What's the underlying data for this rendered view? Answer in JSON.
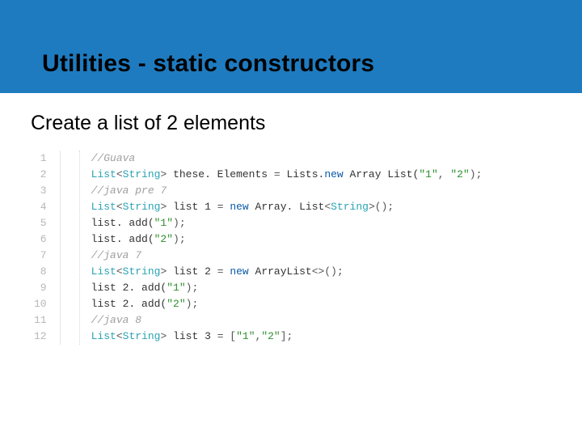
{
  "header": {
    "title": "Utilities - static constructors"
  },
  "subhead": "Create a list of 2 elements",
  "code": {
    "lines": [
      {
        "n": "1",
        "tokens": [
          {
            "t": "//Guava",
            "c": "comment"
          }
        ]
      },
      {
        "n": "2",
        "tokens": [
          {
            "t": "List",
            "c": "type"
          },
          {
            "t": "<",
            "c": "op"
          },
          {
            "t": "String",
            "c": "generic"
          },
          {
            "t": ">",
            "c": "op"
          },
          {
            "t": " these. Elements ",
            "c": "id"
          },
          {
            "t": "=",
            "c": "op"
          },
          {
            "t": " Lists.",
            "c": "id"
          },
          {
            "t": "new",
            "c": "kw"
          },
          {
            "t": " Array List(",
            "c": "id"
          },
          {
            "t": "\"1\"",
            "c": "str"
          },
          {
            "t": ", ",
            "c": "op"
          },
          {
            "t": "\"2\"",
            "c": "str"
          },
          {
            "t": ");",
            "c": "op"
          }
        ]
      },
      {
        "n": "3",
        "tokens": [
          {
            "t": "//java pre 7",
            "c": "comment"
          }
        ]
      },
      {
        "n": "4",
        "tokens": [
          {
            "t": "List",
            "c": "type"
          },
          {
            "t": "<",
            "c": "op"
          },
          {
            "t": "String",
            "c": "generic"
          },
          {
            "t": ">",
            "c": "op"
          },
          {
            "t": " list 1 ",
            "c": "id"
          },
          {
            "t": "=",
            "c": "op"
          },
          {
            "t": " ",
            "c": "id"
          },
          {
            "t": "new",
            "c": "kw"
          },
          {
            "t": " Array. List",
            "c": "id"
          },
          {
            "t": "<",
            "c": "op"
          },
          {
            "t": "String",
            "c": "generic"
          },
          {
            "t": ">",
            "c": "op"
          },
          {
            "t": "();",
            "c": "op"
          }
        ]
      },
      {
        "n": "5",
        "tokens": [
          {
            "t": "list. add(",
            "c": "id"
          },
          {
            "t": "\"1\"",
            "c": "str"
          },
          {
            "t": ");",
            "c": "op"
          }
        ]
      },
      {
        "n": "6",
        "tokens": [
          {
            "t": "list. add(",
            "c": "id"
          },
          {
            "t": "\"2\"",
            "c": "str"
          },
          {
            "t": ");",
            "c": "op"
          }
        ]
      },
      {
        "n": "7",
        "tokens": [
          {
            "t": "//java 7",
            "c": "comment"
          }
        ]
      },
      {
        "n": "8",
        "tokens": [
          {
            "t": "List",
            "c": "type"
          },
          {
            "t": "<",
            "c": "op"
          },
          {
            "t": "String",
            "c": "generic"
          },
          {
            "t": ">",
            "c": "op"
          },
          {
            "t": " list 2 ",
            "c": "id"
          },
          {
            "t": "=",
            "c": "op"
          },
          {
            "t": " ",
            "c": "id"
          },
          {
            "t": "new",
            "c": "kw"
          },
          {
            "t": " ArrayList",
            "c": "id"
          },
          {
            "t": "<>",
            "c": "op"
          },
          {
            "t": "();",
            "c": "op"
          }
        ]
      },
      {
        "n": "9",
        "tokens": [
          {
            "t": "list 2. add(",
            "c": "id"
          },
          {
            "t": "\"1\"",
            "c": "str"
          },
          {
            "t": ");",
            "c": "op"
          }
        ]
      },
      {
        "n": "10",
        "tokens": [
          {
            "t": "list 2. add(",
            "c": "id"
          },
          {
            "t": "\"2\"",
            "c": "str"
          },
          {
            "t": ");",
            "c": "op"
          }
        ]
      },
      {
        "n": "11",
        "tokens": [
          {
            "t": "//java 8",
            "c": "comment"
          }
        ]
      },
      {
        "n": "12",
        "tokens": [
          {
            "t": "List",
            "c": "type"
          },
          {
            "t": "<",
            "c": "op"
          },
          {
            "t": "String",
            "c": "generic"
          },
          {
            "t": ">",
            "c": "op"
          },
          {
            "t": " list 3 ",
            "c": "id"
          },
          {
            "t": "=",
            "c": "op"
          },
          {
            "t": " [",
            "c": "op"
          },
          {
            "t": "\"1\"",
            "c": "str"
          },
          {
            "t": ",",
            "c": "op"
          },
          {
            "t": "\"2\"",
            "c": "str"
          },
          {
            "t": "];",
            "c": "op"
          }
        ]
      }
    ]
  }
}
